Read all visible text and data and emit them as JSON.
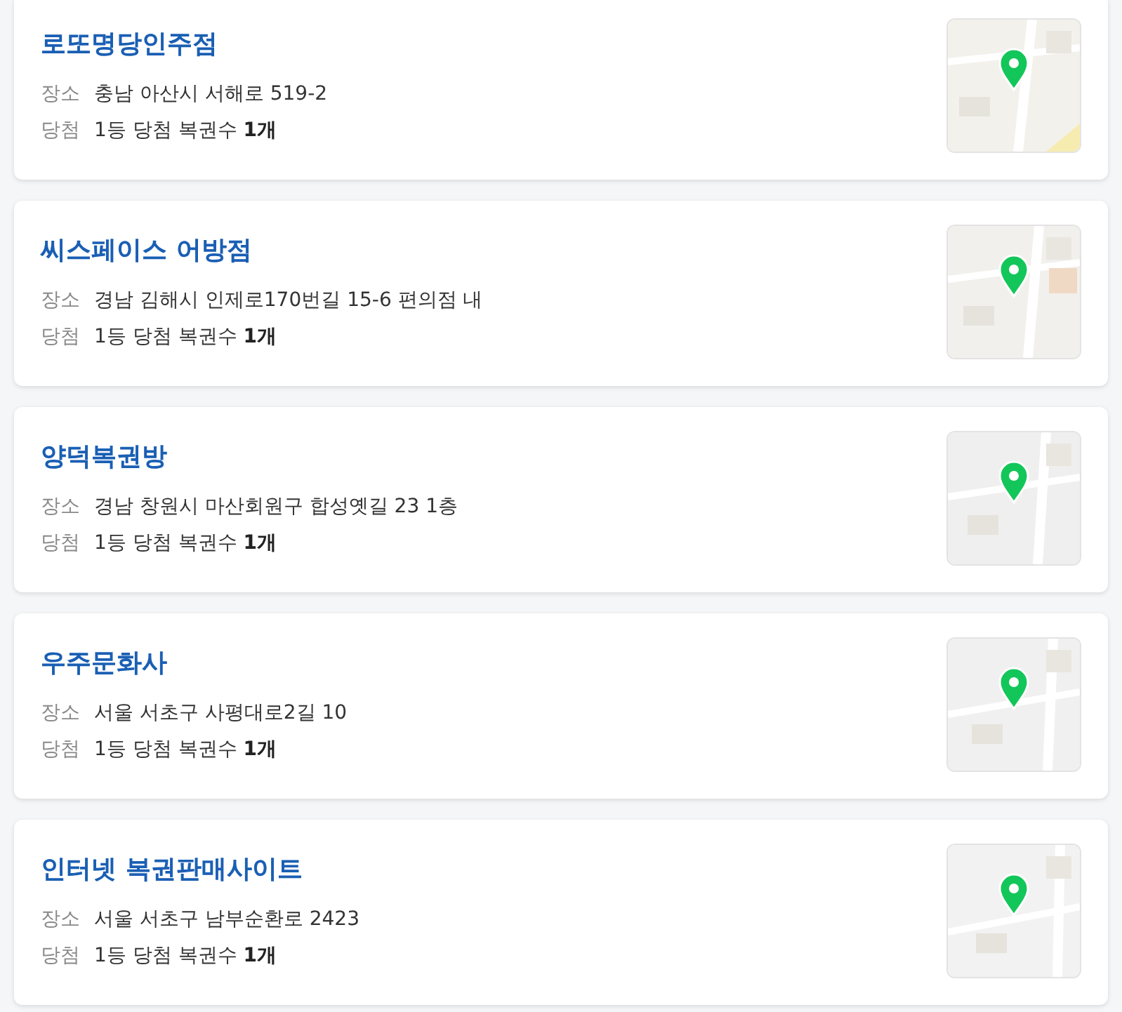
{
  "stores": [
    {
      "name": "로또명당인주점",
      "place_label": "장소",
      "address": "충남 아산시 서해로 519-2",
      "win_label": "당첨",
      "win_text": "1등 당첨 복권수 **1개**"
    },
    {
      "name": "씨스페이스 어방점",
      "place_label": "장소",
      "address": "경남 김해시 인제로170번길 15-6 편의점 내",
      "win_label": "당첨",
      "win_text": "1등 당첨 복권수 **1개**"
    },
    {
      "name": "양덕복권방",
      "place_label": "장소",
      "address": "경남 창원시 마산회원구 합성옛길 23 1층",
      "win_label": "당첨",
      "win_text": "1등 당첨 복권수 **1개**"
    },
    {
      "name": "우주문화사",
      "place_label": "장소",
      "address": "서울 서초구 사평대로2길 10",
      "win_label": "당첨",
      "win_text": "1등 당첨 복권수 **1개**"
    },
    {
      "name": "인터넷 복권판매사이트",
      "place_label": "장소",
      "address": "서울 서초구 남부순환로 2423",
      "win_label": "당첨",
      "win_text": "1등 당첨 복권수 **1개**"
    }
  ]
}
